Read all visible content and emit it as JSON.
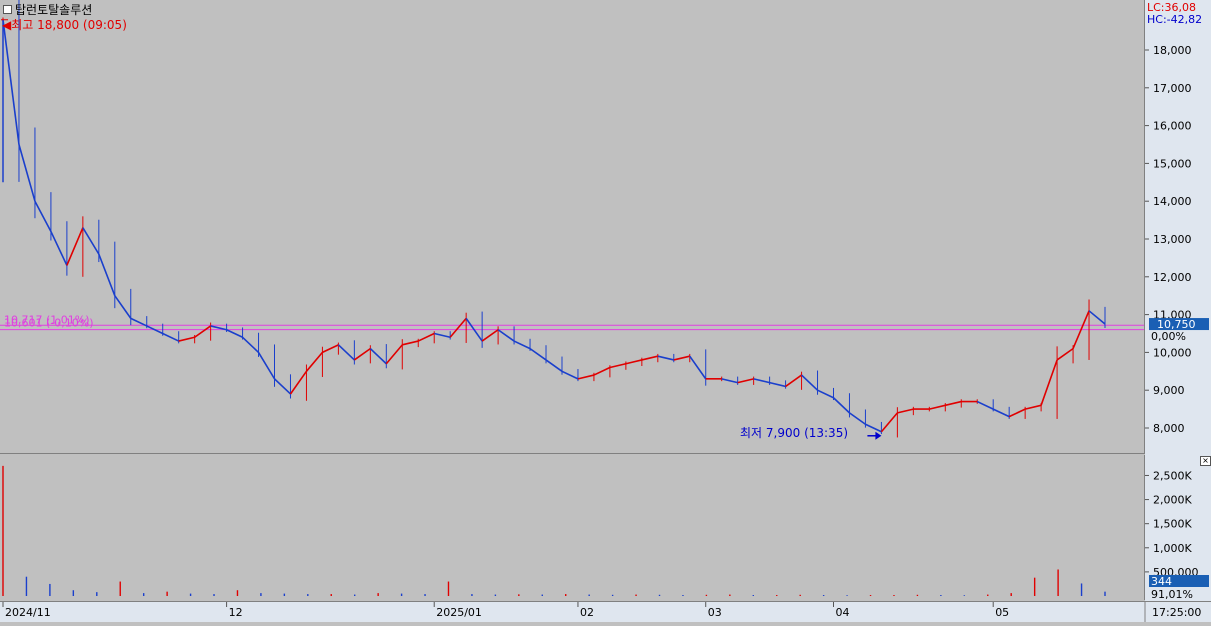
{
  "title": "탑런토탈솔루션",
  "indicators": {
    "lc": "LC:36,08",
    "hc": "HC:-42,82"
  },
  "annotations": {
    "high": "최고 18,800 (09:05)",
    "low": "최저 7,900 (13:35)",
    "level1": "10,717 (1,01%)",
    "level2": "10,601 (-0,10%)"
  },
  "current_price_label": "10,750",
  "change_label": "0,00%",
  "current_volume_label": "344",
  "volume_pct_label": "91,01%",
  "time_label": "17:25:00",
  "colors": {
    "up": "#e00000",
    "down": "#1a3fcc",
    "level": "#e040e0",
    "badge": "#1a5fb4",
    "background": "#c0c0c0"
  },
  "chart_data": [
    {
      "type": "line",
      "series_kind": "price candlestick",
      "x_tick_labels": [
        "2024/11",
        "12",
        "2025/01",
        "02",
        "03",
        "04",
        "05"
      ],
      "y_tick_labels": [
        "8,000",
        "9,000",
        "10,000",
        "11,000",
        "12,000",
        "13,000",
        "14,000",
        "15,000",
        "16,000",
        "17,000",
        "18,000"
      ],
      "ylim": [
        7500,
        19000
      ],
      "points": [
        [
          "2024/11",
          18800
        ],
        [
          "",
          15500
        ],
        [
          "",
          14000
        ],
        [
          "",
          13200
        ],
        [
          "",
          12300
        ],
        [
          "",
          13300
        ],
        [
          "",
          12600
        ],
        [
          "",
          11500
        ],
        [
          "",
          10900
        ],
        [
          "",
          10700
        ],
        [
          "",
          10500
        ],
        [
          "",
          10300
        ],
        [
          "",
          10400
        ],
        [
          "",
          10700
        ],
        [
          "12",
          10600
        ],
        [
          "",
          10400
        ],
        [
          "",
          10000
        ],
        [
          "",
          9300
        ],
        [
          "",
          8900
        ],
        [
          "",
          9500
        ],
        [
          "",
          10000
        ],
        [
          "",
          10200
        ],
        [
          "",
          9800
        ],
        [
          "",
          10100
        ],
        [
          "",
          9700
        ],
        [
          "",
          10200
        ],
        [
          "",
          10300
        ],
        [
          "2025/01",
          10500
        ],
        [
          "",
          10400
        ],
        [
          "",
          10900
        ],
        [
          "",
          10300
        ],
        [
          "",
          10600
        ],
        [
          "",
          10300
        ],
        [
          "",
          10100
        ],
        [
          "",
          9800
        ],
        [
          "",
          9500
        ],
        [
          "02",
          9300
        ],
        [
          "",
          9400
        ],
        [
          "",
          9600
        ],
        [
          "",
          9700
        ],
        [
          "",
          9800
        ],
        [
          "",
          9900
        ],
        [
          "",
          9800
        ],
        [
          "",
          9900
        ],
        [
          "03",
          9300
        ],
        [
          "",
          9300
        ],
        [
          "",
          9200
        ],
        [
          "",
          9300
        ],
        [
          "",
          9200
        ],
        [
          "",
          9100
        ],
        [
          "",
          9400
        ],
        [
          "",
          9000
        ],
        [
          "04",
          8800
        ],
        [
          "",
          8400
        ],
        [
          "",
          8100
        ],
        [
          "",
          7900
        ],
        [
          "",
          8400
        ],
        [
          "",
          8500
        ],
        [
          "",
          8500
        ],
        [
          "",
          8600
        ],
        [
          "",
          8700
        ],
        [
          "",
          8700
        ],
        [
          "05",
          8500
        ],
        [
          "",
          8300
        ],
        [
          "",
          8500
        ],
        [
          "",
          8600
        ],
        [
          "",
          9800
        ],
        [
          "",
          10100
        ],
        [
          "",
          11100
        ],
        [
          "",
          10750
        ]
      ],
      "levels": [
        10717,
        10601
      ],
      "high": 18800,
      "low": 7900,
      "current": 10750
    },
    {
      "type": "bar",
      "series_kind": "volume",
      "y_tick_labels": [
        "500,000",
        "1,000K",
        "1,500K",
        "2,000K",
        "2,500K"
      ],
      "ylim": [
        0,
        2800000
      ],
      "values": [
        2700000,
        400000,
        250000,
        120000,
        80000,
        300000,
        60000,
        90000,
        50000,
        40000,
        120000,
        60000,
        50000,
        40000,
        40000,
        30000,
        60000,
        50000,
        40000,
        300000,
        40000,
        30000,
        35000,
        30000,
        40000,
        30000,
        25000,
        30000,
        25000,
        20000,
        25000,
        30000,
        20000,
        20000,
        25000,
        20000,
        15000,
        20000,
        20000,
        25000,
        20000,
        15000,
        30000,
        60000,
        380000,
        550000,
        260000,
        90000
      ]
    }
  ]
}
